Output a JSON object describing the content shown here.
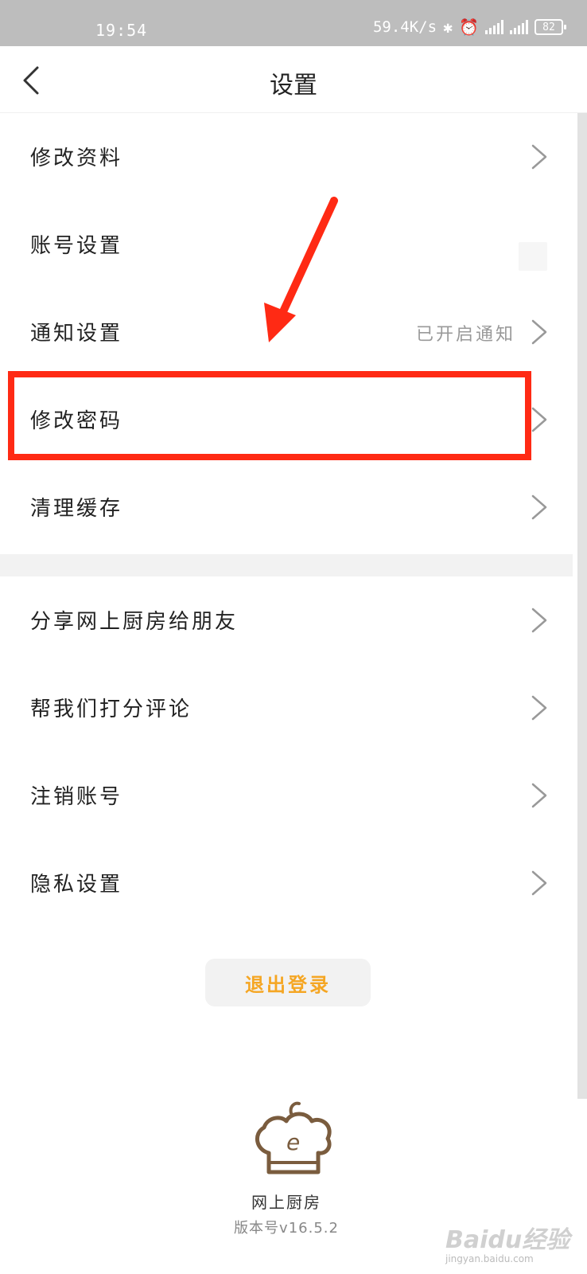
{
  "status_bar": {
    "time": "19:54",
    "network_speed": "59.4K/s",
    "battery": "82",
    "icons": [
      "bluetooth-icon",
      "alarm-icon",
      "signal-5g-icon",
      "signal-4g-icon",
      "battery-icon"
    ]
  },
  "nav": {
    "title": "设置",
    "back_icon": "chevron-left-icon"
  },
  "settings": {
    "group1": [
      {
        "label": "修改资料"
      },
      {
        "label": "账号设置"
      },
      {
        "label": "通知设置",
        "value": "已开启通知"
      },
      {
        "label": "修改密码"
      },
      {
        "label": "清理缓存"
      }
    ],
    "group2": [
      {
        "label": "分享网上厨房给朋友"
      },
      {
        "label": "帮我们打分评论"
      },
      {
        "label": "注销账号"
      },
      {
        "label": "隐私设置"
      }
    ]
  },
  "logout": {
    "label": "退出登录"
  },
  "footer": {
    "brand": "网上厨房",
    "version": "版本号v16.5.2"
  },
  "colors": {
    "accent": "#f5a623",
    "annotation": "#ff2a14",
    "logo": "#7a5c3e"
  },
  "watermark": {
    "text": "Baidu经验",
    "sub": "jingyan.baidu.com"
  }
}
